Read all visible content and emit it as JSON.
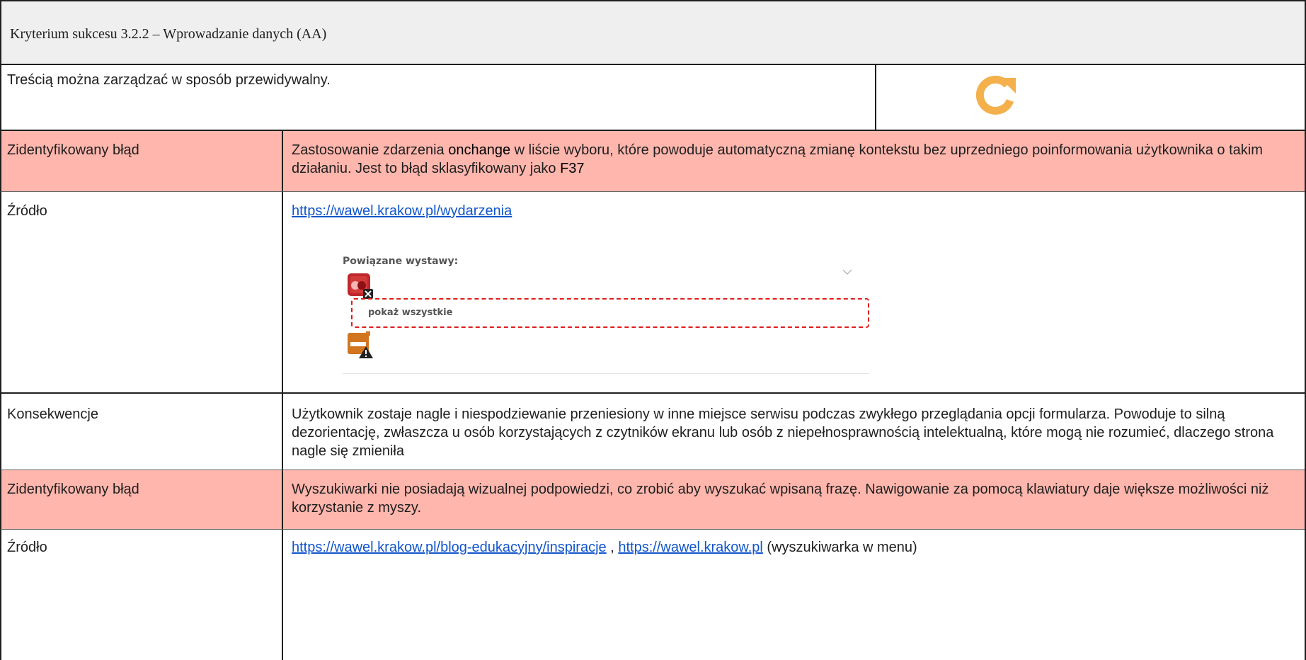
{
  "header": {
    "title": "Kryterium sukcesu 3.2.2 –  Wprowadzanie danych (AA)",
    "subtitle": "Treścią można zarządzać w sposób przewidywalny.",
    "icon": "refresh-icon",
    "icon_color": "#f4b04a"
  },
  "rows": [
    {
      "label": "Zidentyfikowany błąd",
      "text_a": "Zastosowanie zdarzenia ",
      "kw1": "onchange",
      "text_b": " w liście wyboru, które powoduje automatyczną zmianę kontekstu bez uprzedniego poinformowania użytkownika o takim działaniu. Jest to błąd sklasyfikowany jako ",
      "kw2": "F37"
    },
    {
      "label": "Źródło",
      "link": "https://wawel.krakow.pl/wydarzenia",
      "screenshot": {
        "heading": "Powiązane wystawy:",
        "option": "pokaż wszystkie"
      }
    },
    {
      "label": "Konsekwencje",
      "text": "Użytkownik zostaje nagle i niespodziewanie przeniesiony w inne miejsce serwisu podczas zwykłego przeglądania opcji formularza. Powoduje to silną dezorientację, zwłaszcza u osób korzystających z czytników ekranu lub osób z niepełnosprawnością intelektualną, które mogą nie rozumieć, dlaczego strona nagle się zmieniła"
    },
    {
      "label": "Zidentyfikowany błąd",
      "text": "Wyszukiwarki nie posiadają wizualnej podpowiedzi, co zrobić aby wyszukać wpisaną frazę. Nawigowanie za pomocą klawiatury daje większe możliwości niż korzystanie z myszy."
    },
    {
      "label": "Źródło",
      "link1": "https://wawel.krakow.pl/blog-edukacyjny/inspiracje",
      "sep": " , ",
      "link2": "https://wawel.krakow.pl",
      "suffix": " (wyszukiwarka w menu)"
    }
  ],
  "colors": {
    "pink": "#ffb6ad",
    "header": "#efefef",
    "link": "#1155cc"
  }
}
